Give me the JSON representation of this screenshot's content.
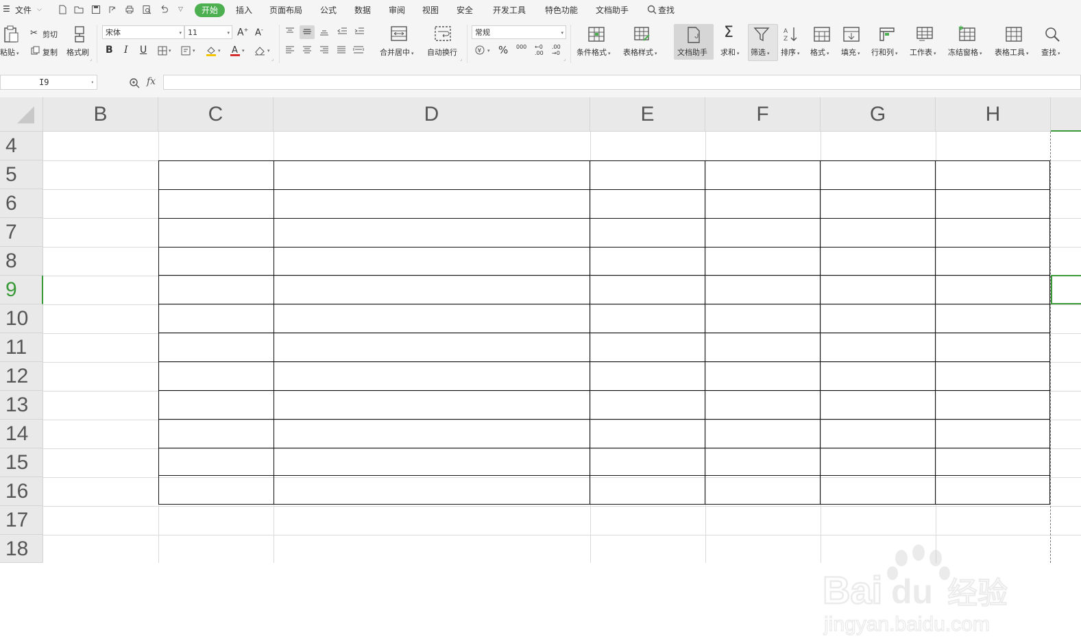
{
  "menubar": {
    "file_label": "文件",
    "tabs": [
      "开始",
      "插入",
      "页面布局",
      "公式",
      "数据",
      "审阅",
      "视图",
      "安全",
      "开发工具",
      "特色功能",
      "文档助手"
    ],
    "active_tab": "开始",
    "search_label": "查找"
  },
  "ribbon": {
    "clipboard": {
      "paste": "粘贴",
      "cut": "剪切",
      "copy": "复制",
      "format_painter": "格式刷"
    },
    "font": {
      "font_name": "宋体",
      "font_size": "11",
      "bold": "B",
      "italic": "I",
      "underline": "U",
      "increase": "A",
      "decrease": "A"
    },
    "alignment": {
      "merge_center": "合并居中",
      "wrap_text": "自动换行"
    },
    "number": {
      "format": "常规",
      "percent": "%",
      "thousands": "000",
      "inc_decimal": ".00",
      "dec_decimal": ".00"
    },
    "styles": {
      "conditional": "条件格式",
      "table_style": "表格样式"
    },
    "doc_assistant": "文档助手",
    "sum": "求和",
    "filter": "筛选",
    "sort": "排序",
    "format": "格式",
    "fill": "填充",
    "row_col": "行和列",
    "worksheet": "工作表",
    "freeze": "冻结窗格",
    "table_tools": "表格工具",
    "find": "查找"
  },
  "formula_bar": {
    "name_box": "I9",
    "fx_label": "fx",
    "formula": ""
  },
  "grid": {
    "columns": [
      "B",
      "C",
      "D",
      "E",
      "F",
      "G",
      "H"
    ],
    "rows": [
      "4",
      "5",
      "6",
      "7",
      "8",
      "9",
      "10",
      "11",
      "12",
      "13",
      "14",
      "15",
      "16",
      "17",
      "18"
    ],
    "selected_cell": "I9",
    "selected_row": "9"
  },
  "watermark": {
    "brand": "Baidu",
    "brand_cn": "经验",
    "url": "jingyan.baidu.com"
  },
  "colors": {
    "accent": "#4caf50",
    "selection": "#3a9a3a",
    "header_bg": "#e9e9e9",
    "toolbar_bg": "#f5f5f5",
    "font_red": "#d32f2f",
    "fill_yellow": "#f5c400"
  }
}
